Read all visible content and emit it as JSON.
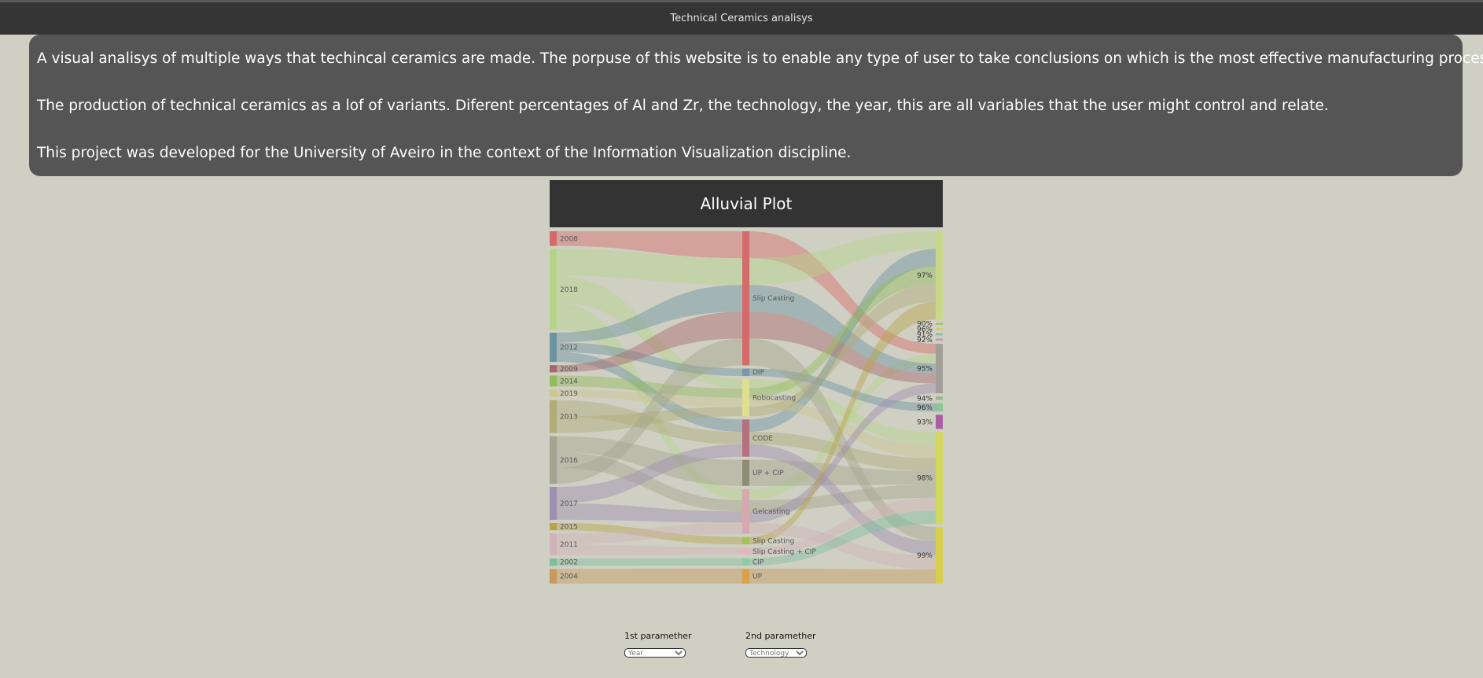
{
  "window": {
    "title": "Technical Ceramics analisys"
  },
  "intro": {
    "paragraphs": [
      "A visual analisys of multiple ways that techincal ceramics are made. The porpuse of this website is to enable any type of user to take conclusions on which is the most effective manufacturing process!",
      "The production of technical ceramics as a lof of variants. Diferent percentages of Al and Zr, the technology, the year, this are all variables that the user might control and relate.",
      "This project was developed for the University of Aveiro in the context of the Information Visualization discipline."
    ]
  },
  "plot": {
    "title": "Alluvial Plot"
  },
  "chart_data": {
    "type": "alluvial",
    "axes": [
      {
        "nodes": [
          {
            "label": "2008",
            "color": "#d46a6a",
            "value": 2
          },
          {
            "label": "2018",
            "color": "#b5d48a",
            "value": 11
          },
          {
            "label": "2012",
            "color": "#6d93a3",
            "value": 4
          },
          {
            "label": "2009",
            "color": "#a8666d",
            "value": 1
          },
          {
            "label": "2014",
            "color": "#93bb5a",
            "value": 1.5
          },
          {
            "label": "2019",
            "color": "#ccc690",
            "value": 1
          },
          {
            "label": "2013",
            "color": "#b0ab77",
            "value": 4.5
          },
          {
            "label": "2016",
            "color": "#a3a38f",
            "value": 6.5
          },
          {
            "label": "2017",
            "color": "#9d8fb0",
            "value": 4.5
          },
          {
            "label": "2015",
            "color": "#b6a446",
            "value": 1
          },
          {
            "label": "2011",
            "color": "#d0b3b8",
            "value": 3
          },
          {
            "label": "2002",
            "color": "#7cbf9d",
            "value": 1
          },
          {
            "label": "2004",
            "color": "#c69a5c",
            "value": 2
          }
        ]
      },
      {
        "nodes": [
          {
            "label": "Slip Casting",
            "color": "#d46a6a",
            "value": 18
          },
          {
            "label": "DIP",
            "color": "#7b98a6",
            "value": 1
          },
          {
            "label": "Robocasting",
            "color": "#dfe08f",
            "value": 5
          },
          {
            "label": "CODE",
            "color": "#b5707d",
            "value": 5
          },
          {
            "label": "UP + CIP",
            "color": "#8f8c75",
            "value": 3.5
          },
          {
            "label": "Gelcasting",
            "color": "#d8a8b0",
            "value": 6
          },
          {
            "label": "Slip Casting",
            "color": "#a3c25c",
            "value": 1
          },
          {
            "label": "Slip Casting + CIP",
            "color": "#e4b6c0",
            "value": 1
          },
          {
            "label": "CIP",
            "color": "#8fcaa8",
            "value": 1
          },
          {
            "label": "UP",
            "color": "#d9a24a",
            "value": 2
          }
        ]
      },
      {
        "nodes": [
          {
            "label": "97%",
            "color": "#c9d88a",
            "value": 12.5
          },
          {
            "label": "90%",
            "color": "#a7c56b",
            "value": 0.3
          },
          {
            "label": "96%",
            "color": "#d4c870",
            "value": 0.3
          },
          {
            "label": "91%",
            "color": "#99b9a8",
            "value": 0.3
          },
          {
            "label": "92%",
            "color": "#b7a0b2",
            "value": 0.3
          },
          {
            "label": "95%",
            "color": "#a19f97",
            "value": 7
          },
          {
            "label": "94%",
            "color": "#9bb896",
            "value": 0.5
          },
          {
            "label": "96%",
            "color": "#8fc595",
            "value": 1.2
          },
          {
            "label": "93%",
            "color": "#aa5fa3",
            "value": 2
          },
          {
            "label": "98%",
            "color": "#d2d85e",
            "value": 13
          },
          {
            "label": "99%",
            "color": "#d7cf4c",
            "value": 8
          }
        ]
      }
    ],
    "flows": [
      {
        "path": [
          0,
          0,
          5
        ]
      },
      {
        "path": [
          1,
          0,
          0
        ]
      },
      {
        "path": [
          1,
          2,
          9
        ]
      },
      {
        "path": [
          1,
          5,
          5
        ]
      },
      {
        "path": [
          2,
          0,
          5
        ]
      },
      {
        "path": [
          2,
          1,
          7
        ]
      },
      {
        "path": [
          2,
          3,
          0
        ]
      },
      {
        "path": [
          3,
          0,
          5
        ]
      },
      {
        "path": [
          4,
          2,
          0
        ]
      },
      {
        "path": [
          5,
          2,
          9
        ]
      },
      {
        "path": [
          6,
          3,
          9
        ]
      },
      {
        "path": [
          6,
          2,
          0
        ]
      },
      {
        "path": [
          7,
          4,
          9
        ]
      },
      {
        "path": [
          7,
          5,
          9
        ]
      },
      {
        "path": [
          7,
          0,
          10
        ]
      },
      {
        "path": [
          8,
          3,
          10
        ]
      },
      {
        "path": [
          8,
          5,
          5
        ]
      },
      {
        "path": [
          9,
          6,
          0
        ]
      },
      {
        "path": [
          10,
          5,
          10
        ]
      },
      {
        "path": [
          10,
          7,
          9
        ]
      },
      {
        "path": [
          11,
          8,
          9
        ]
      },
      {
        "path": [
          12,
          9,
          10
        ]
      }
    ]
  },
  "controls": {
    "first": {
      "label": "1st paramether",
      "value": "Year"
    },
    "second": {
      "label": "2nd paramether",
      "value": "Technology"
    }
  }
}
